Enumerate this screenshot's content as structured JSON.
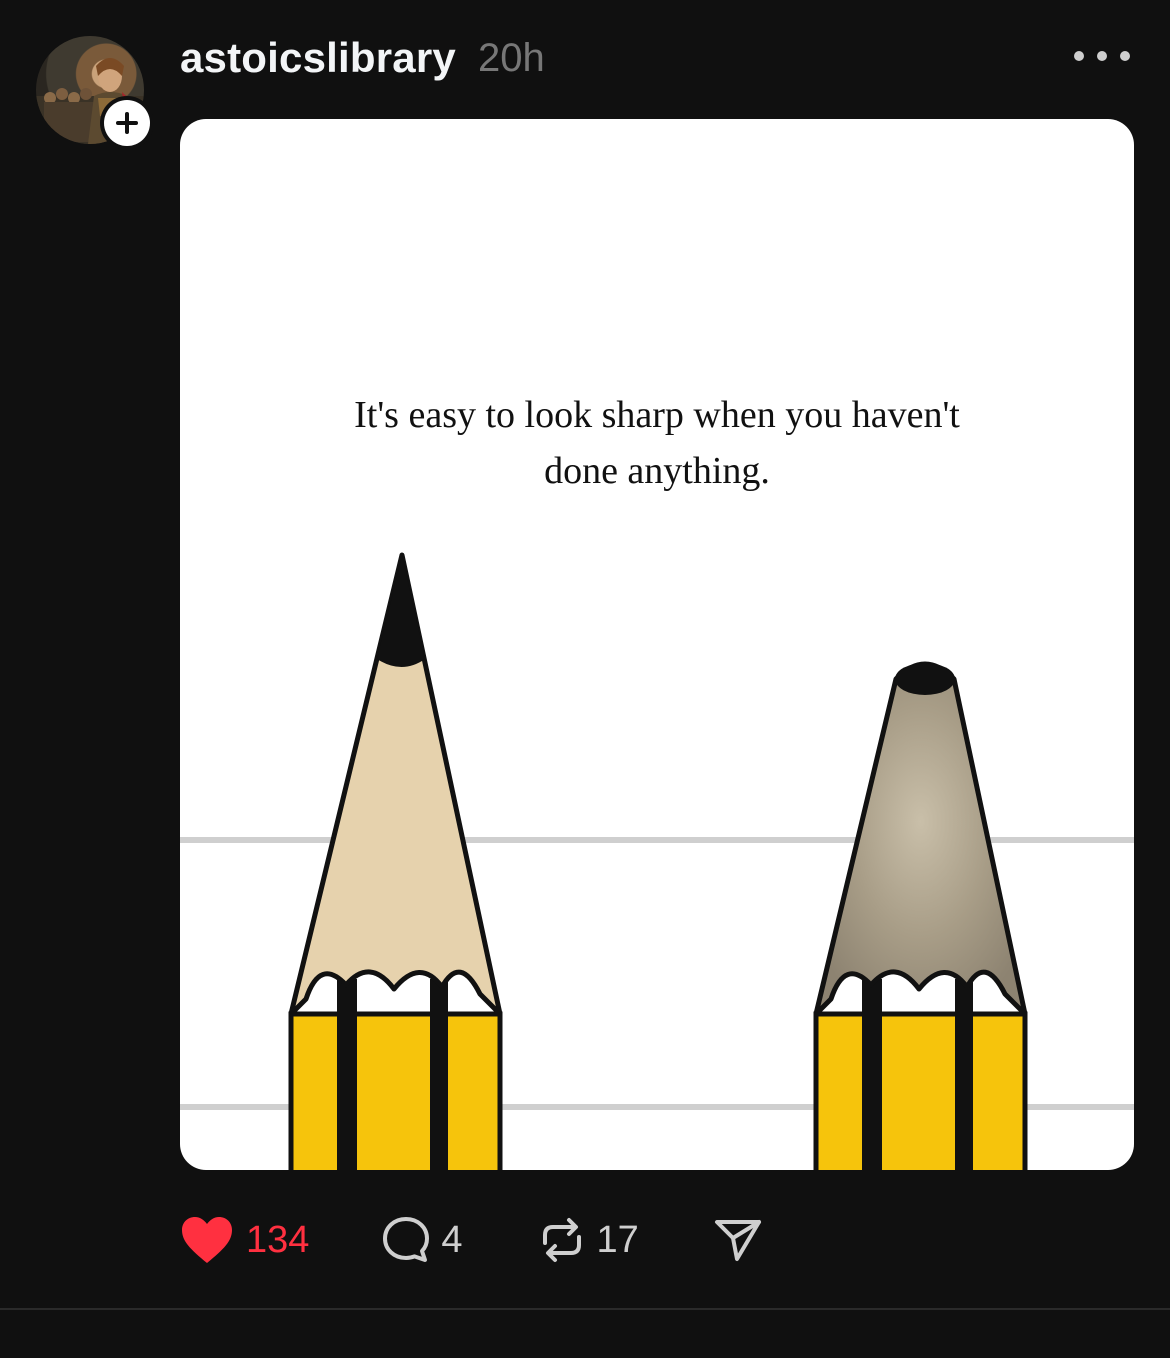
{
  "post": {
    "username": "astoicslibrary",
    "timestamp": "20h",
    "media": {
      "caption_lines": [
        "It's easy to look sharp when you haven't",
        "done anything."
      ]
    },
    "actions": {
      "likes": "134",
      "comments": "4",
      "reposts": "17"
    }
  },
  "icons": {
    "avatar": "avatar-photo",
    "follow": "plus-icon",
    "more": "more-dots-icon",
    "like": "heart-icon",
    "comment": "comment-bubble-icon",
    "repost": "repost-icon",
    "share": "send-icon"
  },
  "colors": {
    "background": "#101010",
    "like_active": "#ff3040",
    "muted_text": "#777777"
  }
}
